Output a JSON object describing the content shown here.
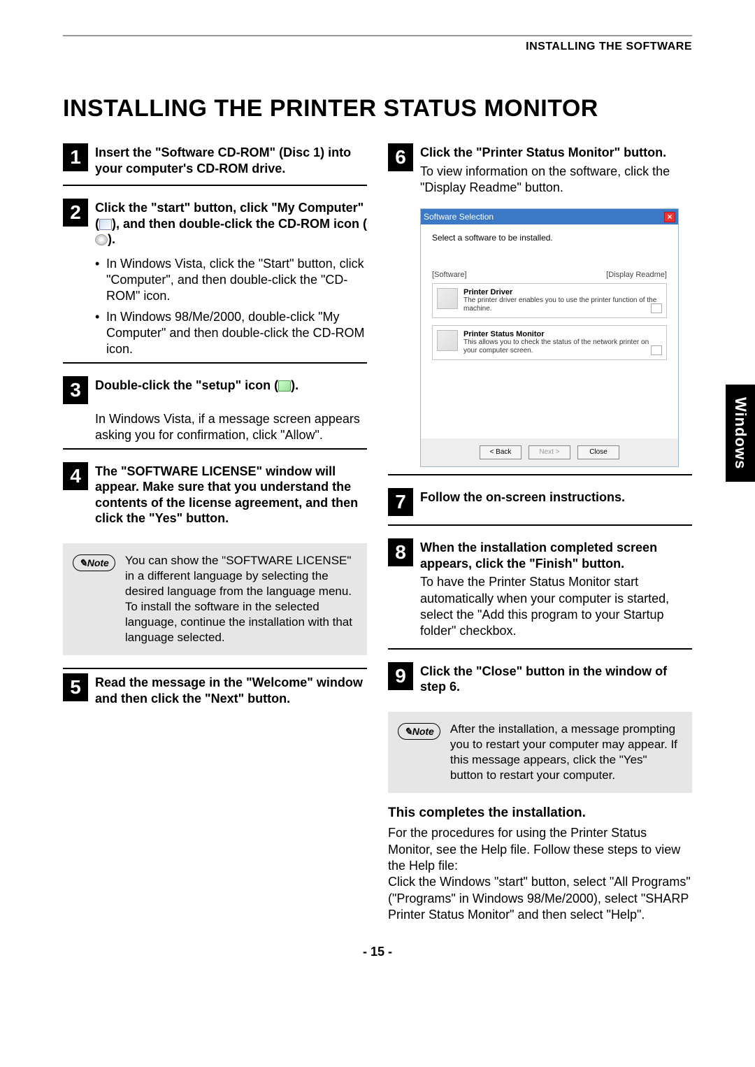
{
  "header": {
    "section": "INSTALLING THE SOFTWARE"
  },
  "title": "INSTALLING THE PRINTER STATUS MONITOR",
  "side_tab": "Windows",
  "page_num": "- 15 -",
  "steps": {
    "s1": {
      "num": "1",
      "title": "Insert the \"Software CD-ROM\" (Disc 1) into your computer's CD-ROM drive."
    },
    "s2": {
      "num": "2",
      "title_a": "Click the \"start\" button, click \"My Computer\" (",
      "title_b": "), and then double-click the CD-ROM icon (",
      "title_c": ").",
      "bullets": [
        "In Windows Vista, click the \"Start\" button, click \"Computer\", and then double-click the \"CD-ROM\" icon.",
        "In Windows 98/Me/2000, double-click \"My Computer\" and then double-click the CD-ROM icon."
      ]
    },
    "s3": {
      "num": "3",
      "title_a": "Double-click the \"setup\" icon (",
      "title_b": ").",
      "body": "In Windows Vista, if a message screen appears asking you for confirmation, click \"Allow\"."
    },
    "s4": {
      "num": "4",
      "title": "The \"SOFTWARE LICENSE\" window will appear. Make sure that you understand the contents of the license agreement, and then click the \"Yes\" button."
    },
    "note1": {
      "label": "Note",
      "text": "You can show the \"SOFTWARE LICENSE\" in a different language by selecting the desired language from the language menu. To install the software in the selected language, continue the installation with that language selected."
    },
    "s5": {
      "num": "5",
      "title": "Read the message in the \"Welcome\" window and then click the \"Next\" button."
    },
    "s6": {
      "num": "6",
      "title": "Click the \"Printer Status Monitor\" button.",
      "body": "To view information on the software, click the \"Display Readme\" button."
    },
    "s7": {
      "num": "7",
      "title": "Follow the on-screen instructions."
    },
    "s8": {
      "num": "8",
      "title": "When the installation completed screen appears, click the \"Finish\" button.",
      "body": "To have the Printer Status Monitor start automatically when your computer is started, select the \"Add this program to your Startup folder\" checkbox."
    },
    "s9": {
      "num": "9",
      "title": "Click the \"Close\" button in the window of step 6."
    },
    "note2": {
      "label": "Note",
      "text": "After the installation, a message prompting you to restart your computer may appear. If this message appears, click the \"Yes\" button to restart your computer."
    }
  },
  "screenshot": {
    "title": "Software Selection",
    "instruction": "Select a software to be installed.",
    "col_left": "[Software]",
    "col_right": "[Display Readme]",
    "item1": {
      "title": "Printer Driver",
      "desc": "The printer driver enables you to use the printer function of the machine."
    },
    "item2": {
      "title": "Printer Status Monitor",
      "desc": "This allows you to check the status of the network printer on your computer screen."
    },
    "btn_back": "< Back",
    "btn_next": "Next >",
    "btn_close": "Close"
  },
  "completion": {
    "head": "This completes the installation.",
    "body1": "For the procedures for using the Printer Status Monitor, see the Help file. Follow these steps to view the Help file:",
    "body2": "Click the Windows \"start\" button, select \"All Programs\" (\"Programs\" in Windows 98/Me/2000), select \"SHARP Printer Status Monitor\" and then select \"Help\"."
  }
}
